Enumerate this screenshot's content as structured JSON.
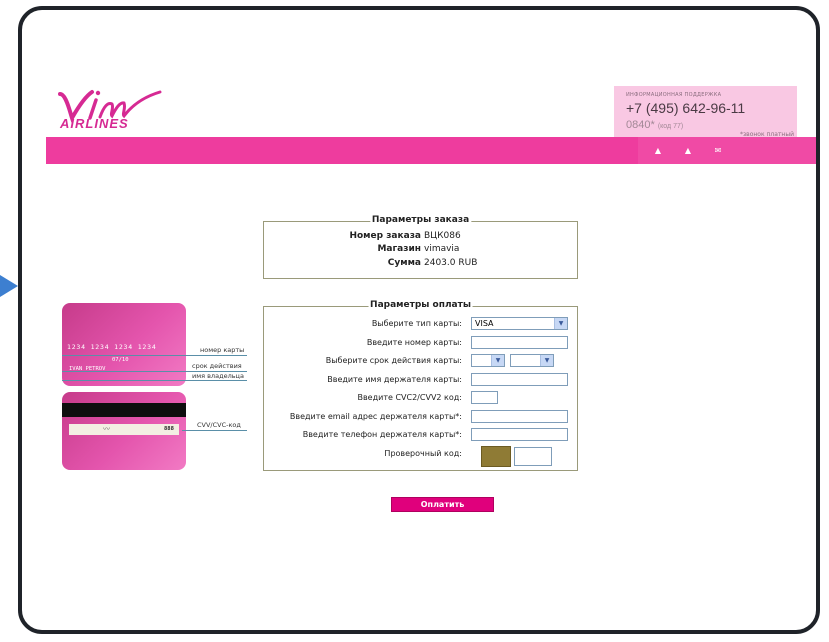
{
  "brand": {
    "logo_text": "AIRLINES"
  },
  "support": {
    "title": "ИНФОРМАЦИОННАЯ ПОДДЕРЖКА",
    "phone": "+7 (495) 642-96-11",
    "short_number": "0840*",
    "short_note": "(код 77)",
    "paid_note": "*звонок платный"
  },
  "nav": {
    "icons": [
      "home-icon",
      "sitemap-icon",
      "mail-icon"
    ]
  },
  "order": {
    "legend": "Параметры заказа",
    "number_label": "Номер заказа",
    "number_value": "ВЦК086",
    "shop_label": "Магазин",
    "shop_value": "vimavia",
    "sum_label": "Сумма",
    "sum_value": "2403.0 RUB"
  },
  "payment": {
    "legend": "Параметры оплаты",
    "card_type_label": "Выберите тип карты:",
    "card_type_value": "VISA",
    "card_number_label": "Введите номер карты:",
    "expiry_label": "Выберите срок действия карты:",
    "holder_label": "Введите имя держателя карты:",
    "cvc_label": "Введите CVC2/CVV2 код:",
    "email_label": "Введите email адрес держателя карты*:",
    "phone_label": "Введите телефон держателя карты*:",
    "captcha_label": "Проверочный код:"
  },
  "card_front": {
    "number": "1234 1234 1234 1234",
    "expiry": "07/10",
    "name": "IVAN PETROV",
    "annot_number": "номер карты",
    "annot_expiry": "срок действия",
    "annot_name": "имя владельца"
  },
  "card_back": {
    "cvv": "888",
    "annot_cvv": "CVV/CVC-код"
  },
  "pay_button": "Оплатить",
  "colors": {
    "accent": "#ee3c9e",
    "support_bg": "#f9c8e3"
  }
}
